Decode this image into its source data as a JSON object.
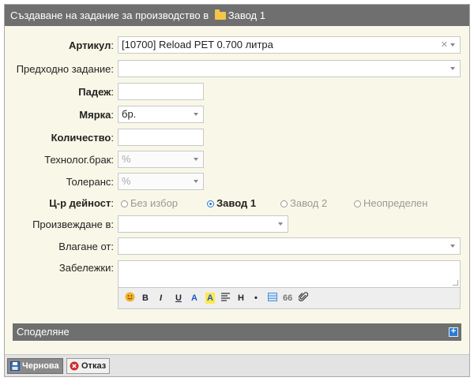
{
  "title": {
    "prefix": "Създаване на задание за производство в",
    "folder": "Завод 1"
  },
  "form": {
    "article": {
      "label": "Артикул",
      "value": "[10700] Reload PET 0.700 литра"
    },
    "previous_task": {
      "label": "Предходно задание:",
      "value": ""
    },
    "due": {
      "label": "Падеж",
      "value": ""
    },
    "unit": {
      "label": "Мярка",
      "value": "бр."
    },
    "quantity": {
      "label": "Количество",
      "value": ""
    },
    "tech_waste": {
      "label": "Технолог.брак:",
      "placeholder": "%"
    },
    "tolerance": {
      "label": "Толеранс:",
      "placeholder": "%"
    },
    "activity_center": {
      "label": "Ц-р дейност",
      "options": [
        "Без избор",
        "Завод 1",
        "Завод 2",
        "Неопределен"
      ],
      "selected": "Завод 1"
    },
    "produce_in": {
      "label": "Произвеждане в:",
      "value": ""
    },
    "input_from": {
      "label": "Влагане от:",
      "value": ""
    },
    "notes": {
      "label": "Забележки:",
      "value": ""
    }
  },
  "editor_toolbar": {
    "items": [
      "emoji",
      "B",
      "I",
      "U",
      "A",
      "A",
      "align",
      "H",
      "•",
      "table",
      "66",
      "attach"
    ]
  },
  "sharing": {
    "label": "Споделяне"
  },
  "buttons": {
    "draft": "Чернова",
    "cancel": "Отказ"
  },
  "colors": {
    "titlebar": "#6f6f6f",
    "panel": "#f9f8e8",
    "accent": "#2a7bd0",
    "cancel": "#cc2b2b"
  }
}
